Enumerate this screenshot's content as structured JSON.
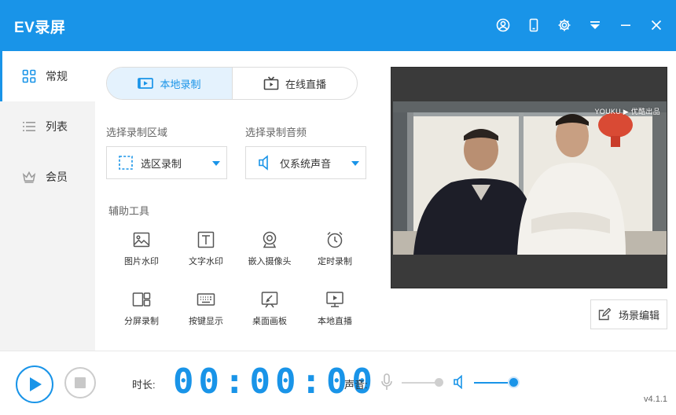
{
  "app": {
    "title": "EV录屏"
  },
  "titlebar": {
    "icons": [
      "user-circle-icon",
      "phone-icon",
      "gear-icon",
      "dropdown-menu-icon",
      "minimize-icon",
      "close-icon"
    ]
  },
  "sidebar": {
    "items": [
      {
        "label": "常规",
        "icon": "grid-icon",
        "active": true
      },
      {
        "label": "列表",
        "icon": "list-icon",
        "active": false
      },
      {
        "label": "会员",
        "icon": "crown-icon",
        "active": false
      }
    ]
  },
  "mode_tabs": [
    {
      "label": "本地录制",
      "icon": "local-record-icon",
      "active": true
    },
    {
      "label": "在线直播",
      "icon": "tv-live-icon",
      "active": false
    }
  ],
  "record_area": {
    "label": "选择录制区域",
    "value": "选区录制",
    "icon": "dashed-region-icon"
  },
  "record_audio": {
    "label": "选择录制音频",
    "value": "仅系统声音",
    "icon": "speaker-icon"
  },
  "tools": {
    "label": "辅助工具",
    "items": [
      {
        "label": "图片水印",
        "icon": "image-icon"
      },
      {
        "label": "文字水印",
        "icon": "text-icon"
      },
      {
        "label": "嵌入摄像头",
        "icon": "webcam-icon"
      },
      {
        "label": "定时录制",
        "icon": "alarm-clock-icon"
      },
      {
        "label": "分屏录制",
        "icon": "split-screen-icon"
      },
      {
        "label": "按键显示",
        "icon": "keyboard-icon"
      },
      {
        "label": "桌面画板",
        "icon": "whiteboard-icon"
      },
      {
        "label": "本地直播",
        "icon": "local-live-icon"
      }
    ]
  },
  "preview": {
    "watermark": "YOUKU ▶ 优酷出品"
  },
  "scene_edit": {
    "label": "场景编辑"
  },
  "bottom": {
    "duration_label": "时长:",
    "timer": "00:00:00",
    "volume_label": "声音:",
    "mic_level": 0.9,
    "speaker_level": 1.0,
    "version": "v4.1.1"
  },
  "colors": {
    "accent": "#1994e8",
    "sidebar_bg": "#f3f3f3",
    "tab_active_bg": "#e4f2fd"
  }
}
